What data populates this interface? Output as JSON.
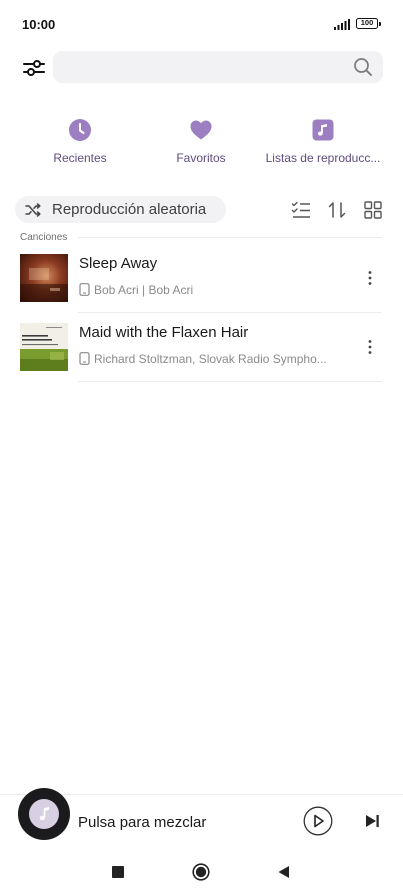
{
  "status": {
    "time": "10:00",
    "battery": "100"
  },
  "search": {
    "placeholder": ""
  },
  "quick_access": [
    {
      "label": "Recientes",
      "icon": "clock-icon"
    },
    {
      "label": "Favoritos",
      "icon": "heart-icon"
    },
    {
      "label": "Listas de reproducc...",
      "icon": "playlist-icon"
    }
  ],
  "toolbar": {
    "shuffle_label": "Reproducción aleatoria"
  },
  "section": {
    "title": "Canciones"
  },
  "songs": [
    {
      "title": "Sleep Away",
      "artist": "Bob Acri | Bob Acri"
    },
    {
      "title": "Maid with the Flaxen Hair",
      "artist": "Richard Stoltzman, Slovak Radio Sympho..."
    }
  ],
  "player": {
    "label": "Pulsa para mezclar"
  },
  "colors": {
    "accent": "#9b7fc0",
    "accent_text": "#5e4c7e",
    "surface": "#f2f2f4"
  }
}
